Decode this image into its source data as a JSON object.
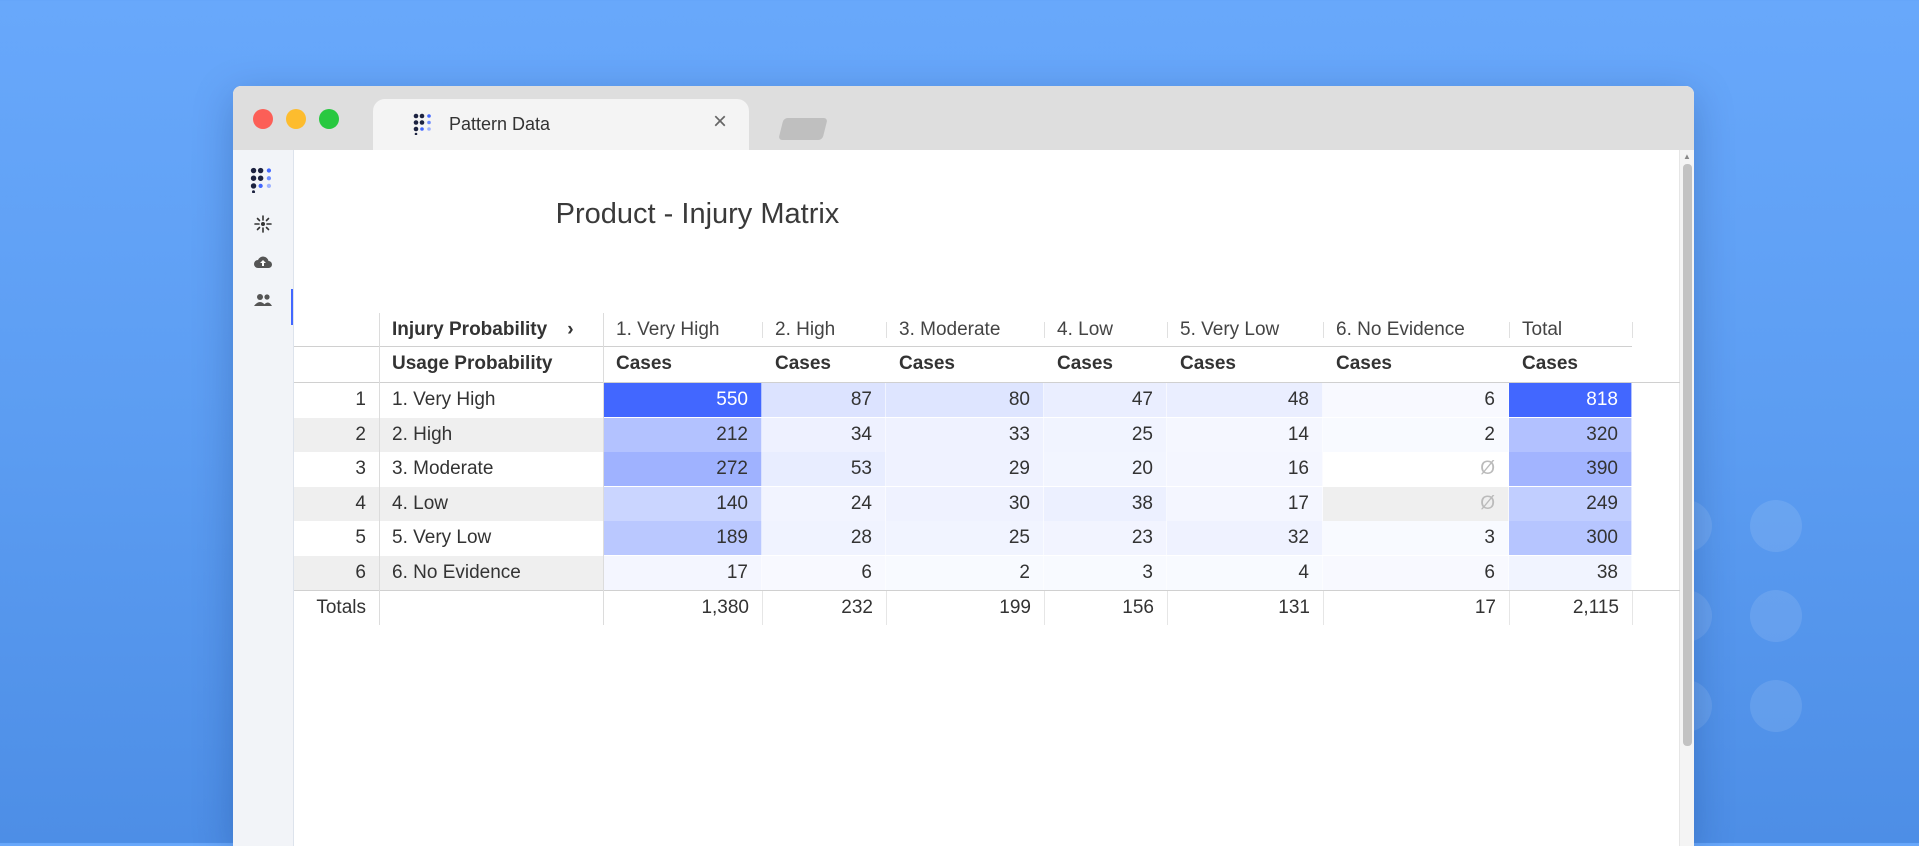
{
  "tab": {
    "title": "Pattern Data"
  },
  "sidebar": {
    "items": [
      "app-logo",
      "sparkle-icon",
      "cloud-upload-icon",
      "people-icon"
    ]
  },
  "report": {
    "title": "Product - Injury Matrix",
    "row_header_1": "Injury Probability",
    "row_header_2": "Usage Probability",
    "columns": [
      "1. Very High",
      "2. High",
      "3. Moderate",
      "4. Low",
      "5. Very Low",
      "6. No Evidence",
      "Total"
    ],
    "measure": "Cases",
    "rows": [
      {
        "index": "1",
        "label": "1. Very High",
        "values": [
          "550",
          "87",
          "80",
          "47",
          "48",
          "6",
          "818"
        ]
      },
      {
        "index": "2",
        "label": "2. High",
        "values": [
          "212",
          "34",
          "33",
          "25",
          "14",
          "2",
          "320"
        ]
      },
      {
        "index": "3",
        "label": "3. Moderate",
        "values": [
          "272",
          "53",
          "29",
          "20",
          "16",
          "Ø",
          "390"
        ]
      },
      {
        "index": "4",
        "label": "4. Low",
        "values": [
          "140",
          "24",
          "30",
          "38",
          "17",
          "Ø",
          "249"
        ]
      },
      {
        "index": "5",
        "label": "5. Very Low",
        "values": [
          "189",
          "28",
          "25",
          "23",
          "32",
          "3",
          "300"
        ]
      },
      {
        "index": "6",
        "label": "6. No Evidence",
        "values": [
          "17",
          "6",
          "2",
          "3",
          "4",
          "6",
          "38"
        ]
      }
    ],
    "totals_label": "Totals",
    "totals": [
      "1,380",
      "232",
      "199",
      "156",
      "131",
      "17",
      "2,115"
    ]
  },
  "colors": {
    "heat_max": "#4267ff",
    "accent": "#4267ff"
  }
}
